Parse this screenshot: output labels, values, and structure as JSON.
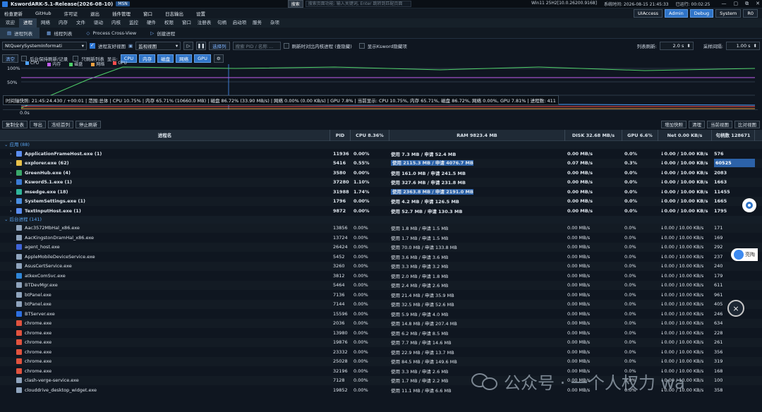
{
  "titlebar": {
    "title": "KswordARK-5.1-Release(2026-08-10)",
    "badge": "MSN",
    "search_label": "搜索",
    "search_placeholder": "搜索页面功能: 输入关键词, Enter 跳转到匹配页面",
    "os": "Win11 25H2[10.0.26200.9168]",
    "time_label": "系统时间: 2026-08-15 21:45:33",
    "uptime_label": "已运行: 00:02:25",
    "min": "—",
    "restore": "▢",
    "max": "⧉",
    "close": "✕"
  },
  "menu": {
    "items": [
      "检查更新",
      "GitHub",
      "许可证",
      "退出",
      "插件管理",
      "窗口",
      "日志输出",
      "设置"
    ],
    "right": [
      "UIAccess",
      "Admin",
      "Debug",
      "System",
      "R0"
    ]
  },
  "tabs": [
    "欢迎",
    "进程",
    "网络",
    "内存",
    "文件",
    "驱动",
    "内核",
    "监控",
    "硬件",
    "权限",
    "窗口",
    "注册表",
    "句柄",
    "启动项",
    "服务",
    "杂项"
  ],
  "subtabs": [
    {
      "icon": "list-icon",
      "label": "进程列表"
    },
    {
      "icon": "thread-icon",
      "label": "线程列表"
    },
    {
      "icon": "crossview-icon",
      "label": "Process Cross-View"
    },
    {
      "icon": "create-icon",
      "label": "创建进程"
    }
  ],
  "toolbar1": {
    "api_combo": "NtQuerySystemInformati",
    "friendly_view": "进程友好视图",
    "view_combo": "监视视图",
    "select_columns": "选择列",
    "search_placeholder": "搜索 PID / 名称 ...",
    "refresh_kernel": "刷新时对比内核进程 (查隐藏)",
    "show_hidden": "显示Ksword隐藏项",
    "list_refresh_label": "列表刷新:",
    "list_refresh_value": "2.0 s",
    "sample_label": "采样间隔:",
    "sample_value": "1.00 s"
  },
  "toolbar2": {
    "clear": "清空",
    "background_keep": "后台保持刷新/记录",
    "only_refresh": "只刷新列表",
    "display_label": "显示:",
    "metrics": [
      "CPU",
      "内存",
      "磁盘",
      "网络",
      "GPU"
    ]
  },
  "graph": {
    "y_labels": [
      "100%",
      "50%"
    ],
    "x_label": "0.0s",
    "legend": [
      {
        "name": "CPU",
        "color": "#4fa3ff"
      },
      {
        "name": "内存",
        "color": "#c05cf0"
      },
      {
        "name": "磁盘",
        "color": "#4fd06a"
      },
      {
        "name": "网络",
        "color": "#f0a040"
      },
      {
        "name": "GPU",
        "color": "#ff4d4d"
      }
    ],
    "tooltip": "时间轴快照: 21:45:24.430 / +00:01 | 范围:总体 | CPU 10.75% | 内存 65.71% (10660.0 MB) | 磁盘 86.72% (33.90 MB/s) | 网络 0.00% (0.00 KB/s) | GPU 7.8% | 当前显示: CPU 10.75%, 内存 65.71%, 磁盘 86.72%, 网络 0.00%, GPU 7.81% | 进程数: 411"
  },
  "table_tools": {
    "left": [
      "复制全表",
      "导出",
      "冻结首列",
      "停止刷新"
    ],
    "right": [
      "增加快照",
      "清理",
      "当前视图",
      "比对视图"
    ]
  },
  "columns": [
    "进程名",
    "PID",
    "CPU 8.36%",
    "RAM 9823.4 MB",
    "DISK 32.68 MB/s",
    "GPU 6.6%",
    "Net 0.00 KB/s",
    "句柄数 128671"
  ],
  "groups": [
    {
      "label": "应用 (88)",
      "rows": [
        {
          "name": "ApplicationFrameHost.exe (1)",
          "icon": "#5b8def",
          "pid": "11936",
          "cpu": "0.00%",
          "ram": "使用 7.3 MB / 申请 52.4 MB",
          "disk": "0.00 MB/s",
          "gpu": "0.0%",
          "net": "↓0.00 / 10.00 KB/s",
          "handles": "576",
          "bold": true,
          "exp": true
        },
        {
          "name": "explorer.exe (62)",
          "icon": "#e8c14a",
          "pid": "5416",
          "cpu": "0.55%",
          "ram": "使用 2115.3 MB / 申请 4076.7 MB",
          "disk": "0.07 MB/s",
          "gpu": "0.3%",
          "net": "↓0.00 / 10.00 KB/s",
          "handles": "60525",
          "bold": true,
          "exp": true,
          "ramhi": true,
          "handlehi": true
        },
        {
          "name": "GreenHub.exe (4)",
          "icon": "#3aa86b",
          "pid": "3580",
          "cpu": "0.00%",
          "ram": "使用 161.0 MB / 申请 241.5 MB",
          "disk": "0.00 MB/s",
          "gpu": "0.0%",
          "net": "↓0.00 / 10.00 KB/s",
          "handles": "2083",
          "bold": true,
          "exp": true
        },
        {
          "name": "Ksword5.1.exe (1)",
          "icon": "#3a7bd5",
          "pid": "37280",
          "cpu": "1.10%",
          "ram": "使用 327.6 MB / 申请 231.8 MB",
          "disk": "0.00 MB/s",
          "gpu": "0.0%",
          "net": "↓0.00 / 10.00 KB/s",
          "handles": "1663",
          "bold": true,
          "exp": true
        },
        {
          "name": "msedge.exe (18)",
          "icon": "#2fb59a",
          "pid": "31988",
          "cpu": "1.74%",
          "ram": "使用 2363.8 MB / 申请 2191.0 MB",
          "disk": "0.00 MB/s",
          "gpu": "0.0%",
          "net": "↓0.00 / 10.00 KB/s",
          "handles": "11455",
          "bold": true,
          "exp": true,
          "ramhi": true
        },
        {
          "name": "SystemSettings.exe (1)",
          "icon": "#4a8ee0",
          "pid": "1796",
          "cpu": "0.00%",
          "ram": "使用 4.2 MB / 申请 126.5 MB",
          "disk": "0.00 MB/s",
          "gpu": "0.0%",
          "net": "↓0.00 / 10.00 KB/s",
          "handles": "1665",
          "bold": true,
          "exp": true
        },
        {
          "name": "TextInputHost.exe (1)",
          "icon": "#5b8def",
          "pid": "9872",
          "cpu": "0.00%",
          "ram": "使用 52.7 MB / 申请 130.3 MB",
          "disk": "0.00 MB/s",
          "gpu": "0.0%",
          "net": "↓0.00 / 10.00 KB/s",
          "handles": "1795",
          "bold": true,
          "exp": true
        }
      ]
    },
    {
      "label": "后台进程 (141)",
      "rows": [
        {
          "name": "Aac3572MbHal_x86.exe",
          "icon": "#8fa4bd",
          "pid": "13856",
          "cpu": "0.00%",
          "ram": "使用 1.8 MB / 申请 1.5 MB",
          "disk": "0.00 MB/s",
          "gpu": "0.0%",
          "net": "↓0.00 / 10.00 KB/s",
          "handles": "171"
        },
        {
          "name": "AacKingstonDramHal_x86.exe",
          "icon": "#8fa4bd",
          "pid": "13724",
          "cpu": "0.00%",
          "ram": "使用 1.7 MB / 申请 1.5 MB",
          "disk": "0.00 MB/s",
          "gpu": "0.0%",
          "net": "↓0.00 / 10.00 KB/s",
          "handles": "169"
        },
        {
          "name": "agent_host.exe",
          "icon": "#3f64d8",
          "pid": "26424",
          "cpu": "0.00%",
          "ram": "使用 70.0 MB / 申请 133.8 MB",
          "disk": "0.00 MB/s",
          "gpu": "0.0%",
          "net": "↓0.00 / 10.00 KB/s",
          "handles": "292"
        },
        {
          "name": "AppleMobileDeviceService.exe",
          "icon": "#8fa4bd",
          "pid": "5452",
          "cpu": "0.00%",
          "ram": "使用 3.6 MB / 申请 3.6 MB",
          "disk": "0.00 MB/s",
          "gpu": "0.0%",
          "net": "↓0.00 / 10.00 KB/s",
          "handles": "237"
        },
        {
          "name": "AsusCertService.exe",
          "icon": "#8fa4bd",
          "pid": "3260",
          "cpu": "0.00%",
          "ram": "使用 3.3 MB / 申请 3.2 MB",
          "disk": "0.00 MB/s",
          "gpu": "0.0%",
          "net": "↓0.00 / 10.00 KB/s",
          "handles": "240"
        },
        {
          "name": "atkexComSvc.exe",
          "icon": "#2f86d8",
          "pid": "3812",
          "cpu": "0.00%",
          "ram": "使用 2.0 MB / 申请 1.8 MB",
          "disk": "0.00 MB/s",
          "gpu": "0.0%",
          "net": "↓0.00 / 10.00 KB/s",
          "handles": "179"
        },
        {
          "name": "BTDevMgr.exe",
          "icon": "#8fa4bd",
          "pid": "5464",
          "cpu": "0.00%",
          "ram": "使用 2.4 MB / 申请 2.6 MB",
          "disk": "0.00 MB/s",
          "gpu": "0.0%",
          "net": "↓0.00 / 10.00 KB/s",
          "handles": "611"
        },
        {
          "name": "btPanel.exe",
          "icon": "#8fa4bd",
          "pid": "7136",
          "cpu": "0.00%",
          "ram": "使用 21.4 MB / 申请 35.9 MB",
          "disk": "0.00 MB/s",
          "gpu": "0.0%",
          "net": "↓0.00 / 10.00 KB/s",
          "handles": "961"
        },
        {
          "name": "btPanel.exe",
          "icon": "#8fa4bd",
          "pid": "7144",
          "cpu": "0.00%",
          "ram": "使用 32.5 MB / 申请 52.6 MB",
          "disk": "0.00 MB/s",
          "gpu": "0.0%",
          "net": "↓0.00 / 10.00 KB/s",
          "handles": "405"
        },
        {
          "name": "BTServer.exe",
          "icon": "#2d6fe0",
          "pid": "15596",
          "cpu": "0.00%",
          "ram": "使用 5.9 MB / 申请 4.0 MB",
          "disk": "0.00 MB/s",
          "gpu": "0.0%",
          "net": "↓0.00 / 10.00 KB/s",
          "handles": "246"
        },
        {
          "name": "chrome.exe",
          "icon": "#e0533f",
          "pid": "2036",
          "cpu": "0.00%",
          "ram": "使用 14.8 MB / 申请 207.4 MB",
          "disk": "0.00 MB/s",
          "gpu": "0.0%",
          "net": "↓0.00 / 10.00 KB/s",
          "handles": "634"
        },
        {
          "name": "chrome.exe",
          "icon": "#e0533f",
          "pid": "13980",
          "cpu": "0.00%",
          "ram": "使用 6.2 MB / 申请 8.5 MB",
          "disk": "0.00 MB/s",
          "gpu": "0.0%",
          "net": "↓0.00 / 10.00 KB/s",
          "handles": "228"
        },
        {
          "name": "chrome.exe",
          "icon": "#e0533f",
          "pid": "19876",
          "cpu": "0.00%",
          "ram": "使用 7.7 MB / 申请 14.6 MB",
          "disk": "0.00 MB/s",
          "gpu": "0.0%",
          "net": "↓0.00 / 10.00 KB/s",
          "handles": "261"
        },
        {
          "name": "chrome.exe",
          "icon": "#e0533f",
          "pid": "23332",
          "cpu": "0.00%",
          "ram": "使用 22.9 MB / 申请 13.7 MB",
          "disk": "0.00 MB/s",
          "gpu": "0.0%",
          "net": "↓0.00 / 10.00 KB/s",
          "handles": "356"
        },
        {
          "name": "chrome.exe",
          "icon": "#e0533f",
          "pid": "25028",
          "cpu": "0.00%",
          "ram": "使用 84.5 MB / 申请 149.6 MB",
          "disk": "0.00 MB/s",
          "gpu": "0.0%",
          "net": "↓0.00 / 10.00 KB/s",
          "handles": "319"
        },
        {
          "name": "chrome.exe",
          "icon": "#e0533f",
          "pid": "32196",
          "cpu": "0.00%",
          "ram": "使用 3.3 MB / 申请 2.6 MB",
          "disk": "0.00 MB/s",
          "gpu": "0.0%",
          "net": "↓0.00 / 10.00 KB/s",
          "handles": "168"
        },
        {
          "name": "clash-verge-service.exe",
          "icon": "#8fa4bd",
          "pid": "7128",
          "cpu": "0.00%",
          "ram": "使用 1.7 MB / 申请 2.2 MB",
          "disk": "0.00 MB/s",
          "gpu": "0.0%",
          "net": "↓0.00 / 10.00 KB/s",
          "handles": "100"
        },
        {
          "name": "clouddrive_desktop_widget.exe",
          "icon": "#8fa4bd",
          "pid": "19852",
          "cpu": "0.00%",
          "ram": "使用 11.1 MB / 申请 6.6 MB",
          "disk": "0.00 MB/s",
          "gpu": "0.0%",
          "net": "↓0.00 / 10.00 KB/s",
          "handles": "358"
        }
      ]
    }
  ],
  "floating": {
    "side_text": "亮陶"
  },
  "watermark": "公众号 · 一个人权力 wa",
  "colors": {
    "accent": "#2f74c8",
    "bg": "#0f1620"
  }
}
